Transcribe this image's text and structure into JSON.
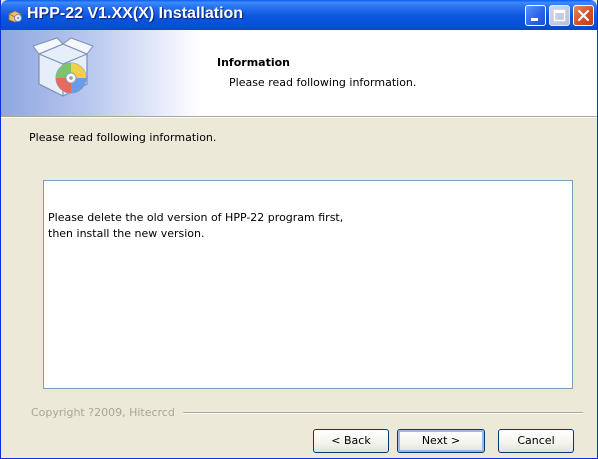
{
  "window": {
    "title": "HPP-22 V1.XX(X) Installation",
    "title_icon": "installer-icon",
    "controls": {
      "minimize_icon": "minimize-icon",
      "maximize_icon": "maximize-icon",
      "close_icon": "close-icon"
    }
  },
  "header": {
    "title": "Information",
    "subtitle": "Please read following information.",
    "icon": "setup-box-cd-icon"
  },
  "content": {
    "intro": "Please read following information.",
    "info_lines": [
      "Please delete the old version of HPP-22 program first,",
      "then install the new version."
    ]
  },
  "footer": {
    "branding": "Copyright ?2009, Hitecrcd",
    "back_label": "< Back",
    "next_label": "Next >",
    "cancel_label": "Cancel"
  },
  "colors": {
    "titlebar": "#0a4fd6",
    "face": "#ece9d8",
    "button_border": "#003c74",
    "close_button": "#d4502a"
  }
}
